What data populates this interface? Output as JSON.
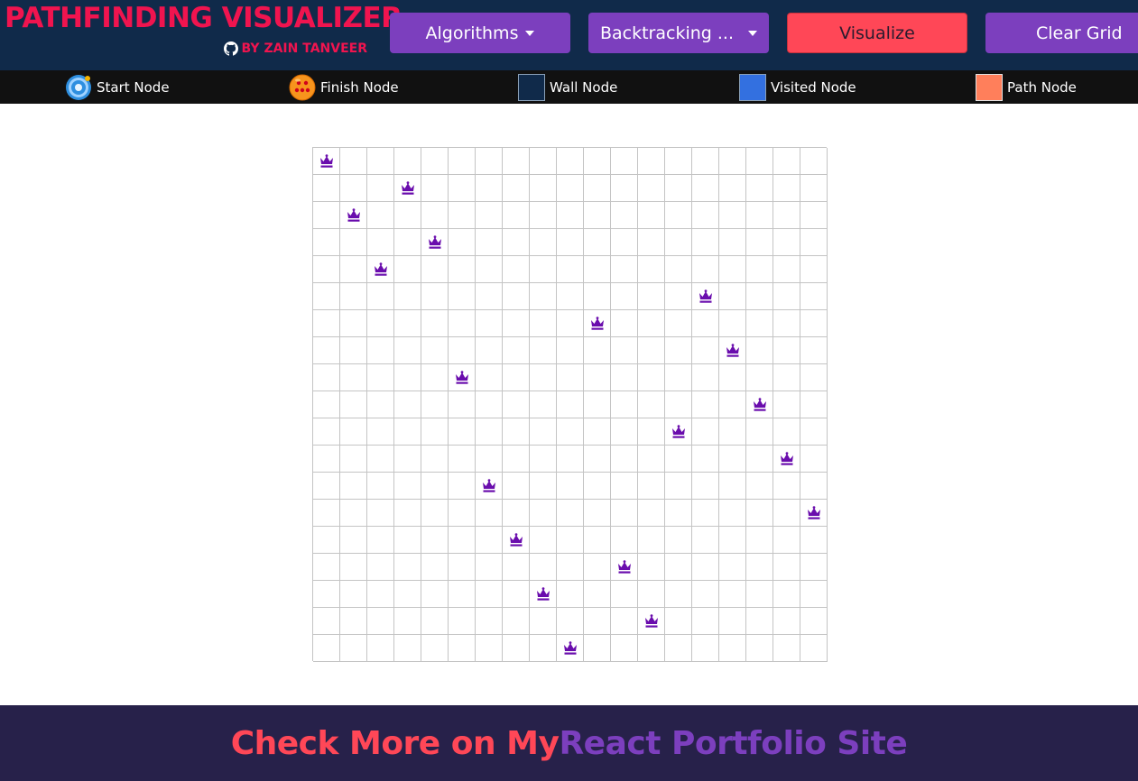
{
  "header": {
    "title": "PATHFINDING VISUALIZER",
    "author": "BY ZAIN TANVEER",
    "algorithms_label": "Algorithms",
    "mode_label": "Backtracking ...",
    "visualize_label": "Visualize",
    "clear_label": "Clear Grid"
  },
  "legend": {
    "items": [
      {
        "label": "Start Node",
        "icon": "start-node-icon"
      },
      {
        "label": "Finish Node",
        "icon": "dragon-ball-icon"
      },
      {
        "label": "Wall Node",
        "color": "#102a4a"
      },
      {
        "label": "Visited Node",
        "color": "#3370e0"
      },
      {
        "label": "Path Node",
        "color": "#ff7f5b"
      }
    ]
  },
  "board": {
    "rows": 19,
    "cols": 19,
    "piece_icon": "queen-icon",
    "piece_color": "#6a0dad",
    "queen_columns_by_row": [
      0,
      3,
      1,
      4,
      2,
      14,
      10,
      15,
      5,
      16,
      13,
      17,
      6,
      18,
      7,
      11,
      8,
      12,
      9
    ]
  },
  "footer": {
    "lead": "Check More on My",
    "link": "React Portfolio Site"
  },
  "colors": {
    "header_bg": "#102a4a",
    "accent_red": "#f0144f",
    "button_purple": "#7c3fbe",
    "button_red": "#ff4757",
    "footer_bg": "#27214a"
  }
}
